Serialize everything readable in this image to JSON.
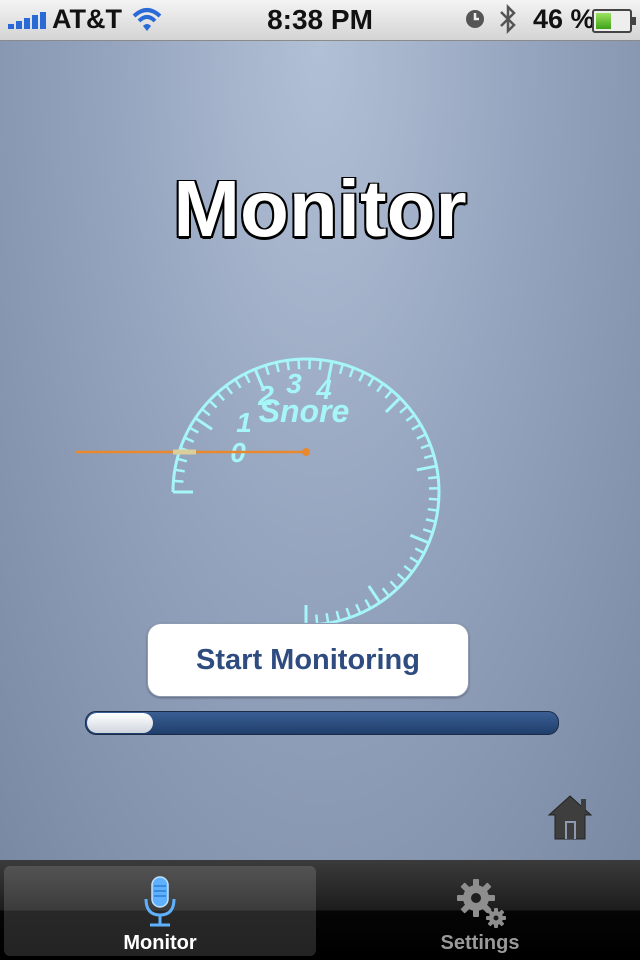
{
  "status_bar": {
    "carrier": "AT&T",
    "time": "8:38 PM",
    "battery_percent": "46 %",
    "battery_level": 0.46,
    "icons": [
      "signal-icon",
      "wifi-icon",
      "alarm-icon",
      "bluetooth-icon",
      "battery-icon"
    ]
  },
  "main": {
    "title": "Monitor",
    "gauge": {
      "label": "Snore",
      "scale_labels": [
        "0",
        "1",
        "2",
        "3",
        "4"
      ],
      "needle_value": 0
    },
    "start_button_label": "Start Monitoring",
    "progress_level": 0.14,
    "home_icon": "home-icon"
  },
  "tab_bar": {
    "tabs": [
      {
        "label": "Monitor",
        "icon": "microphone-icon",
        "selected": true
      },
      {
        "label": "Settings",
        "icon": "gear-icon",
        "selected": false
      }
    ]
  },
  "colors": {
    "gauge_cyan": "#a6f6f8",
    "needle": "#e8892f",
    "button_text": "#2f4c80",
    "progress_track": "#2a4b7c"
  }
}
